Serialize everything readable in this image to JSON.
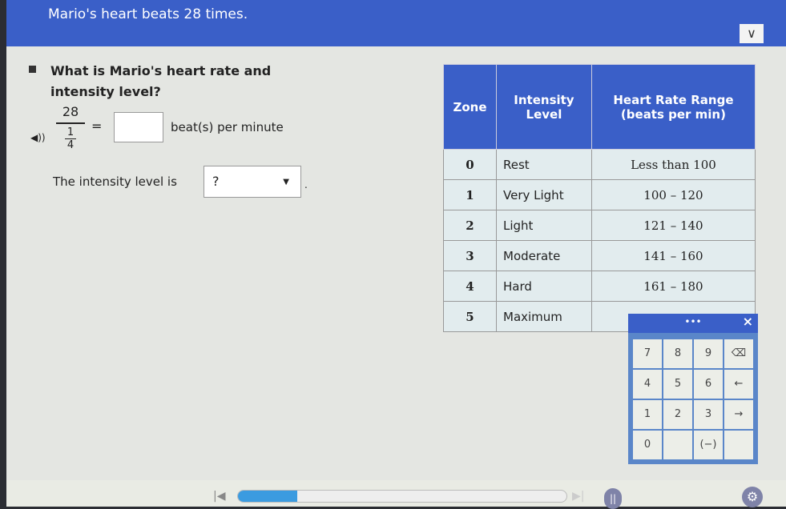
{
  "header": {
    "title": "Mario's heart beats 28 times.",
    "collapse_icon": "chevron-down-icon"
  },
  "question": {
    "prompt": "What is Mario's heart rate and intensity level?",
    "numerator": "28",
    "denominator_num": "1",
    "denominator_den": "4",
    "equals": "=",
    "unit": "beat(s) per minute",
    "answer_value": "",
    "intensity_label": "The intensity level is",
    "dropdown_value": "?",
    "period": "."
  },
  "table": {
    "headers": [
      "Zone",
      "Intensity Level",
      "Heart Rate Range (beats per min)"
    ],
    "rows": [
      [
        "0",
        "Rest",
        "Less than 100"
      ],
      [
        "1",
        "Very Light",
        "100 – 120"
      ],
      [
        "2",
        "Light",
        "121 – 140"
      ],
      [
        "3",
        "Moderate",
        "141 – 160"
      ],
      [
        "4",
        "Hard",
        "161 – 180"
      ],
      [
        "5",
        "Maximum",
        ""
      ]
    ]
  },
  "keypad": {
    "title": "•••",
    "close": "×",
    "keys": [
      "7",
      "8",
      "9",
      "⌫",
      "4",
      "5",
      "6",
      "←",
      "1",
      "2",
      "3",
      "→",
      "0",
      "",
      "(−)",
      ""
    ]
  },
  "media": {
    "progress_percent": 18,
    "prev": "|◀",
    "next": "▶|",
    "pause": "||",
    "settings": "⚙"
  }
}
